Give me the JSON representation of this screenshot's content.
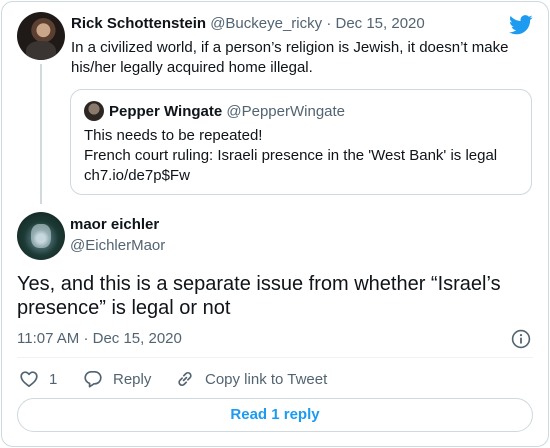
{
  "parent_tweet": {
    "name": "Rick Schottenstein",
    "handle": "@Buckeye_ricky",
    "separator": "·",
    "date": "Dec 15, 2020",
    "text": "In a civilized world, if a person’s religion is Jewish, it doesn’t make his/her legally acquired home illegal."
  },
  "quoted_tweet": {
    "name": "Pepper Wingate",
    "handle": "@PepperWingate",
    "lines": [
      "This needs to be repeated!",
      "French court ruling: Israeli presence in the 'West Bank' is legal",
      "ch7.io/de7p$Fw"
    ]
  },
  "main_tweet": {
    "name": "maor eichler",
    "handle": "@EichlerMaor",
    "text": "Yes, and this is a separate issue from whether “Israel’s presence” is legal or not",
    "time": "11:07 AM",
    "separator": "·",
    "date": "Dec 15, 2020"
  },
  "actions": {
    "like_count": "1",
    "reply_label": "Reply",
    "copy_label": "Copy link to Tweet"
  },
  "read_replies_label": "Read 1 reply",
  "icons": {
    "brand": "twitter-bird-icon",
    "info": "info-icon",
    "like": "heart-icon",
    "reply": "speech-bubble-icon",
    "copy": "link-icon"
  },
  "colors": {
    "accent": "#1d9bf0",
    "muted": "#536471",
    "border": "#cfd9de"
  }
}
